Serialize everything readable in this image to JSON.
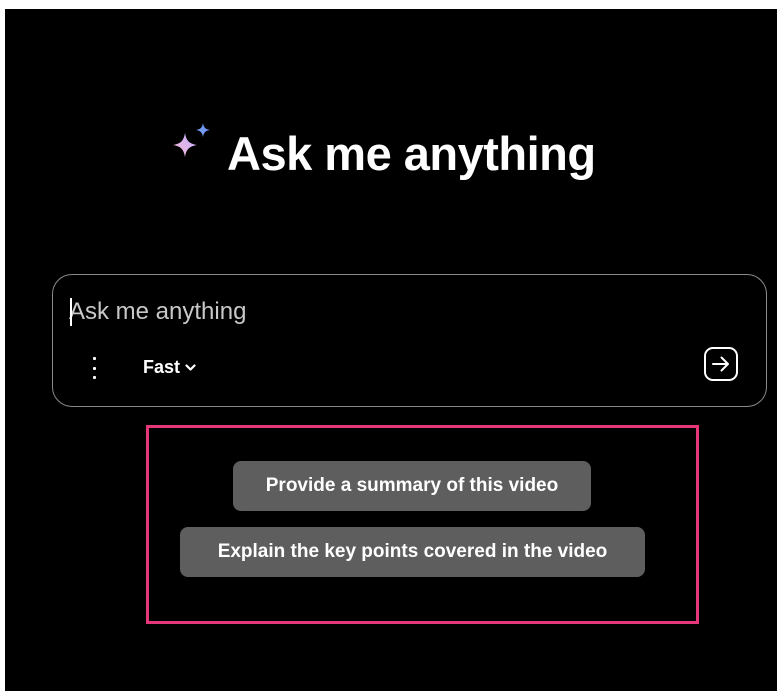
{
  "heading": {
    "text": "Ask me anything",
    "icon": "sparkle-icon"
  },
  "composer": {
    "placeholder": "Ask me anything",
    "value": "",
    "more_icon": "vertical-ellipsis-icon",
    "mode_label": "Fast",
    "mode_icon": "chevron-down-icon",
    "send_icon": "arrow-right-icon"
  },
  "suggestions": [
    {
      "label": "Provide a summary of this video"
    },
    {
      "label": "Explain the key points covered in the video"
    }
  ],
  "colors": {
    "background": "#000000",
    "text": "#ffffff",
    "chip_background": "#5e5e5e",
    "highlight_border": "#e5387a",
    "composer_border": "#8a8a8a",
    "sparkle_gradient": [
      "#f9a8c8",
      "#c9a7f5",
      "#6fa2f7"
    ]
  }
}
